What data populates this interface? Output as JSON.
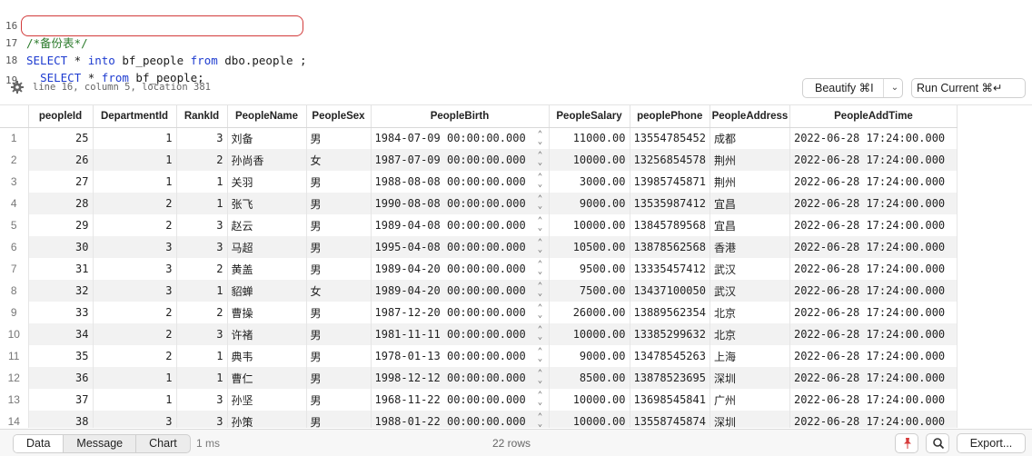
{
  "editor": {
    "lines": [
      {
        "num": "16",
        "comment": "/*备份表*/"
      },
      {
        "num": "17",
        "kw1": "SELECT",
        "t1": " * ",
        "kw2": "into",
        "t2": " bf_people ",
        "kw3": "from",
        "t3": " dbo.people ;"
      },
      {
        "num": "18",
        "indent": "  ",
        "kw1": "SELECT",
        "t1": " * ",
        "kw2": "from",
        "t2": " bf_people;"
      },
      {
        "num": "19"
      }
    ]
  },
  "status": {
    "location": "line 16, column 5, location 381",
    "beautify_label": "Beautify ⌘I",
    "run_label": "Run Current ⌘↵",
    "gear_icon": "gear-icon"
  },
  "grid": {
    "columns": [
      "peopleId",
      "DepartmentId",
      "RankId",
      "PeopleName",
      "PeopleSex",
      "PeopleBirth",
      "PeopleSalary",
      "peoplePhone",
      "PeopleAddress",
      "PeopleAddTime"
    ],
    "rows": [
      {
        "n": "1",
        "id": "25",
        "dept": "1",
        "rank": "3",
        "name": "刘备",
        "sex": "男",
        "birth": "1984-07-09 00:00:00.000",
        "salary": "11000.00",
        "phone": "13554785452",
        "addr": "成都",
        "added": "2022-06-28 17:24:00.000"
      },
      {
        "n": "2",
        "id": "26",
        "dept": "1",
        "rank": "2",
        "name": "孙尚香",
        "sex": "女",
        "birth": "1987-07-09 00:00:00.000",
        "salary": "10000.00",
        "phone": "13256854578",
        "addr": "荆州",
        "added": "2022-06-28 17:24:00.000"
      },
      {
        "n": "3",
        "id": "27",
        "dept": "1",
        "rank": "1",
        "name": "关羽",
        "sex": "男",
        "birth": "1988-08-08 00:00:00.000",
        "salary": "3000.00",
        "phone": "13985745871",
        "addr": "荆州",
        "added": "2022-06-28 17:24:00.000"
      },
      {
        "n": "4",
        "id": "28",
        "dept": "2",
        "rank": "1",
        "name": "张飞",
        "sex": "男",
        "birth": "1990-08-08 00:00:00.000",
        "salary": "9000.00",
        "phone": "13535987412",
        "addr": "宜昌",
        "added": "2022-06-28 17:24:00.000"
      },
      {
        "n": "5",
        "id": "29",
        "dept": "2",
        "rank": "3",
        "name": "赵云",
        "sex": "男",
        "birth": "1989-04-08 00:00:00.000",
        "salary": "10000.00",
        "phone": "13845789568",
        "addr": "宜昌",
        "added": "2022-06-28 17:24:00.000"
      },
      {
        "n": "6",
        "id": "30",
        "dept": "3",
        "rank": "3",
        "name": "马超",
        "sex": "男",
        "birth": "1995-04-08 00:00:00.000",
        "salary": "10500.00",
        "phone": "13878562568",
        "addr": "香港",
        "added": "2022-06-28 17:24:00.000"
      },
      {
        "n": "7",
        "id": "31",
        "dept": "3",
        "rank": "2",
        "name": "黄盖",
        "sex": "男",
        "birth": "1989-04-20 00:00:00.000",
        "salary": "9500.00",
        "phone": "13335457412",
        "addr": "武汉",
        "added": "2022-06-28 17:24:00.000"
      },
      {
        "n": "8",
        "id": "32",
        "dept": "3",
        "rank": "1",
        "name": "貂蝉",
        "sex": "女",
        "birth": "1989-04-20 00:00:00.000",
        "salary": "7500.00",
        "phone": "13437100050",
        "addr": "武汉",
        "added": "2022-06-28 17:24:00.000"
      },
      {
        "n": "9",
        "id": "33",
        "dept": "2",
        "rank": "2",
        "name": "曹操",
        "sex": "男",
        "birth": "1987-12-20 00:00:00.000",
        "salary": "26000.00",
        "phone": "13889562354",
        "addr": "北京",
        "added": "2022-06-28 17:24:00.000"
      },
      {
        "n": "10",
        "id": "34",
        "dept": "2",
        "rank": "3",
        "name": "许褚",
        "sex": "男",
        "birth": "1981-11-11 00:00:00.000",
        "salary": "10000.00",
        "phone": "13385299632",
        "addr": "北京",
        "added": "2022-06-28 17:24:00.000"
      },
      {
        "n": "11",
        "id": "35",
        "dept": "2",
        "rank": "1",
        "name": "典韦",
        "sex": "男",
        "birth": "1978-01-13 00:00:00.000",
        "salary": "9000.00",
        "phone": "13478545263",
        "addr": "上海",
        "added": "2022-06-28 17:24:00.000"
      },
      {
        "n": "12",
        "id": "36",
        "dept": "1",
        "rank": "1",
        "name": "曹仁",
        "sex": "男",
        "birth": "1998-12-12 00:00:00.000",
        "salary": "8500.00",
        "phone": "13878523695",
        "addr": "深圳",
        "added": "2022-06-28 17:24:00.000"
      },
      {
        "n": "13",
        "id": "37",
        "dept": "1",
        "rank": "3",
        "name": "孙坚",
        "sex": "男",
        "birth": "1968-11-22 00:00:00.000",
        "salary": "10000.00",
        "phone": "13698545841",
        "addr": "广州",
        "added": "2022-06-28 17:24:00.000"
      },
      {
        "n": "14",
        "id": "38",
        "dept": "3",
        "rank": "3",
        "name": "孙策",
        "sex": "男",
        "birth": "1988-01-22 00:00:00.000",
        "salary": "10000.00",
        "phone": "13558745874",
        "addr": "深圳",
        "added": "2022-06-28 17:24:00.000"
      }
    ]
  },
  "bottom": {
    "tabs": [
      "Data",
      "Message",
      "Chart"
    ],
    "active_tab": "Data",
    "timing": "1 ms",
    "row_count": "22 rows",
    "export_label": "Export...",
    "pin_icon": "pin-icon",
    "search_icon": "search-icon"
  },
  "colors": {
    "keyword": "#1d3bd0",
    "comment": "#2a7a2a",
    "highlight_border": "#d23a3a",
    "pin_red": "#d63a3a"
  }
}
